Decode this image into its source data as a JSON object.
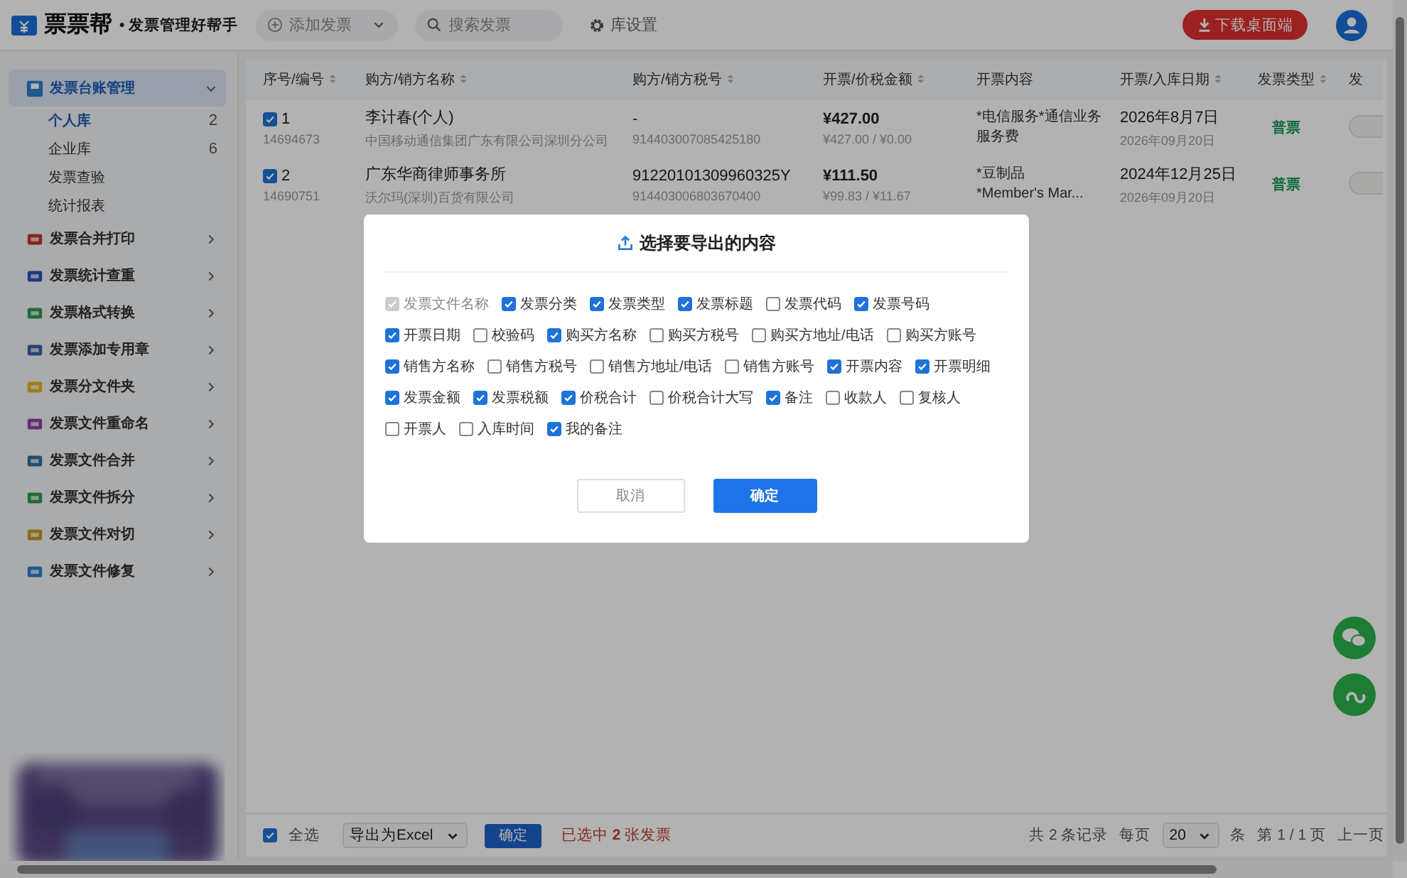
{
  "header": {
    "logo": "票票帮",
    "tagline": "• 发票管理好帮手",
    "add_button": "添加发票",
    "search": {
      "placeholder": "搜索发票"
    },
    "settings": "库设置",
    "download_button": "下载桌面端"
  },
  "sidebar": {
    "groups": [
      {
        "label": "发票台账管理",
        "expanded": true,
        "selected": true,
        "children": [
          {
            "label": "个人库",
            "count": "2",
            "selected": true
          },
          {
            "label": "企业库",
            "count": "6",
            "selected": false
          },
          {
            "label": "发票查验",
            "selected": false
          },
          {
            "label": "统计报表",
            "selected": false
          }
        ]
      },
      {
        "label": "发票合并打印",
        "expanded": false,
        "selected": false
      },
      {
        "label": "发票统计查重",
        "expanded": false,
        "selected": false
      },
      {
        "label": "发票格式转换",
        "expanded": false,
        "selected": false
      },
      {
        "label": "发票添加专用章",
        "expanded": false,
        "selected": false
      },
      {
        "label": "发票分文件夹",
        "expanded": false,
        "selected": false
      },
      {
        "label": "发票文件重命名",
        "expanded": false,
        "selected": false
      },
      {
        "label": "发票文件合并",
        "expanded": false,
        "selected": false
      },
      {
        "label": "发票文件拆分",
        "expanded": false,
        "selected": false
      },
      {
        "label": "发票文件对切",
        "expanded": false,
        "selected": false
      },
      {
        "label": "发票文件修复",
        "expanded": false,
        "selected": false
      }
    ]
  },
  "table": {
    "columns": [
      {
        "label": "序号/编号",
        "sortable": true
      },
      {
        "label": "购方/销方名称",
        "sortable": true
      },
      {
        "label": "购方/销方税号",
        "sortable": true
      },
      {
        "label": "开票/价税金额",
        "sortable": true
      },
      {
        "label": "开票内容",
        "sortable": false
      },
      {
        "label": "开票/入库日期",
        "sortable": true
      },
      {
        "label": "发票类型",
        "sortable": true
      },
      {
        "label": "发"
      }
    ],
    "rows": [
      {
        "checked": true,
        "index": "1",
        "number": "14694673",
        "buyer": "李计春(个人)",
        "seller": "中国移动通信集团广东有限公司深圳分公司",
        "buyer_tax": "-",
        "seller_tax": "914403007085425180",
        "total": "¥427.00",
        "breakdown": "¥427.00 / ¥0.00",
        "content": "*电信服务*通信业务服务费",
        "date": "2026年8月7日",
        "stored": "2026年09月20日",
        "type": "普票"
      },
      {
        "checked": true,
        "index": "2",
        "number": "14690751",
        "buyer": "广东华商律师事务所",
        "seller": "沃尔玛(深圳)百货有限公司",
        "buyer_tax": "91220101309960325Y",
        "seller_tax": "914403006803670400",
        "total": "¥111.50",
        "breakdown": "¥99.83 / ¥11.67",
        "content": "*豆制品\n*Member's Mar...",
        "date": "2024年12月25日",
        "stored": "2026年09月20日",
        "type": "普票"
      }
    ]
  },
  "footer": {
    "select_all": {
      "label": "全选",
      "checked": true
    },
    "export_format": "导出为Excel",
    "confirm": "确定",
    "selected_note": "已选中 **2** 张发票",
    "total": "共 2 条记录",
    "per_page_label": "每页",
    "per_page": "20",
    "per_page_unit": "条",
    "page": "第 1 / 1 页",
    "prev": "上一页"
  },
  "dialog": {
    "title": "选择要导出的内容",
    "options": [
      {
        "label": "发票文件名称",
        "checked": true,
        "disabled": true
      },
      {
        "label": "发票分类",
        "checked": true,
        "disabled": false
      },
      {
        "label": "发票类型",
        "checked": true,
        "disabled": false
      },
      {
        "label": "发票标题",
        "checked": true,
        "disabled": false
      },
      {
        "label": "发票代码",
        "checked": false,
        "disabled": false
      },
      {
        "label": "发票号码",
        "checked": true,
        "disabled": false
      },
      {
        "label": "开票日期",
        "checked": true,
        "disabled": false
      },
      {
        "label": "校验码",
        "checked": false,
        "disabled": false
      },
      {
        "label": "购买方名称",
        "checked": true,
        "disabled": false
      },
      {
        "label": "购买方税号",
        "checked": false,
        "disabled": false
      },
      {
        "label": "购买方地址/电话",
        "checked": false,
        "disabled": false
      },
      {
        "label": "购买方账号",
        "checked": false,
        "disabled": false
      },
      {
        "label": "销售方名称",
        "checked": true,
        "disabled": false
      },
      {
        "label": "销售方税号",
        "checked": false,
        "disabled": false
      },
      {
        "label": "销售方地址/电话",
        "checked": false,
        "disabled": false
      },
      {
        "label": "销售方账号",
        "checked": false,
        "disabled": false
      },
      {
        "label": "开票内容",
        "checked": true,
        "disabled": false
      },
      {
        "label": "开票明细",
        "checked": true,
        "disabled": false
      },
      {
        "label": "发票金额",
        "checked": true,
        "disabled": false
      },
      {
        "label": "发票税额",
        "checked": true,
        "disabled": false
      },
      {
        "label": "价税合计",
        "checked": true,
        "disabled": false
      },
      {
        "label": "价税合计大写",
        "checked": false,
        "disabled": false
      },
      {
        "label": "备注",
        "checked": true,
        "disabled": false
      },
      {
        "label": "收款人",
        "checked": false,
        "disabled": false
      },
      {
        "label": "复核人",
        "checked": false,
        "disabled": false
      },
      {
        "label": "开票人",
        "checked": false,
        "disabled": false
      },
      {
        "label": "入库时间",
        "checked": false,
        "disabled": false
      },
      {
        "label": "我的备注",
        "checked": true,
        "disabled": false
      }
    ],
    "cancel": "取消",
    "confirm": "确定"
  }
}
